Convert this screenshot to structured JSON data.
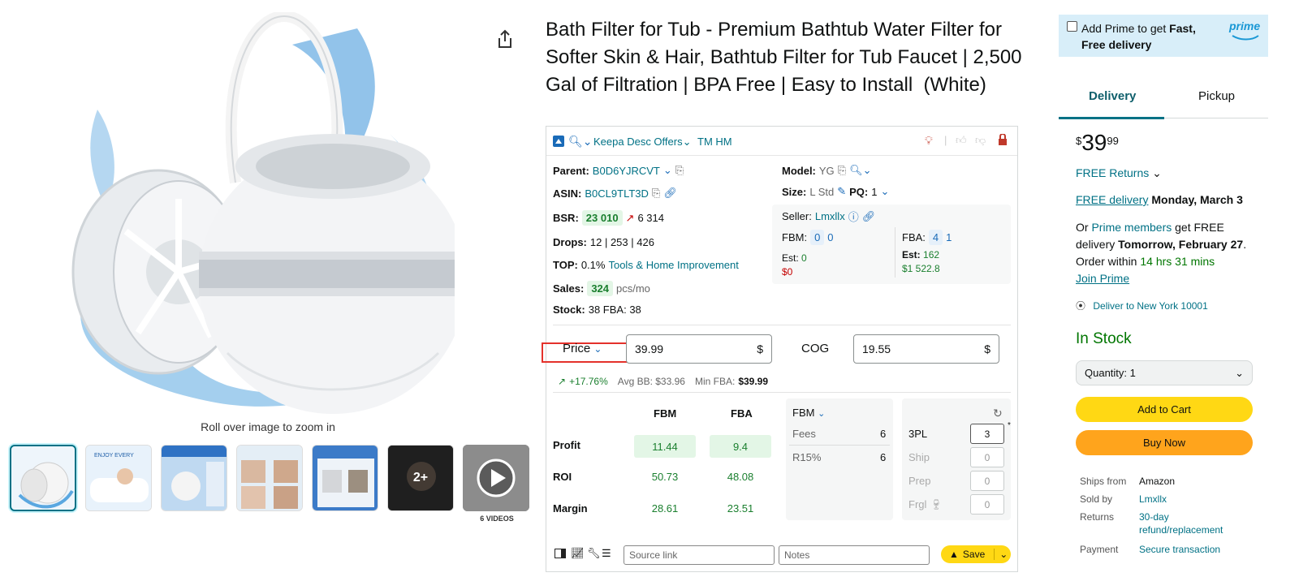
{
  "product": {
    "title": "Bath Filter for Tub - Premium Bathtub Water Filter for Softer Skin & Hair, Bathtub Filter for Tub Faucet | 2,500 Gal of Filtration | BPA Free | Easy to Install  (White)"
  },
  "gallery": {
    "zoom_hint": "Roll over image to zoom in",
    "more_count": "2+",
    "videos_label": "6 VIDEOS"
  },
  "keepa": {
    "toolbar": {
      "menu_label": "Keepa Desc Offers",
      "tm_label": "TM HM"
    },
    "parent_label": "Parent:",
    "parent_value": "B0D6YJRCVT",
    "asin_label": "ASIN:",
    "asin_value": "B0CL9TLT3D",
    "bsr_label": "BSR:",
    "bsr_value": "23 010",
    "bsr_trend": "6 314",
    "drops_label": "Drops:",
    "drops_value": "12 | 253 | 426",
    "top_label": "TOP:",
    "top_value": "0.1%",
    "top_category": "Tools & Home Improvement",
    "sales_label": "Sales:",
    "sales_value": "324",
    "sales_unit": "pcs/mo",
    "stock_label": "Stock:",
    "stock_value": "38 FBA: 38",
    "model_label": "Model:",
    "model_value": "YG",
    "size_label": "Size:",
    "size_value": "L Std",
    "pq_label": "PQ:",
    "pq_value": "1",
    "seller_label": "Seller:",
    "seller_value": "Lmxllx",
    "fbm_label": "FBM:",
    "fbm_count": "0",
    "fbm_count2": "0",
    "fba_label": "FBA:",
    "fba_count": "4",
    "fba_count2": "1",
    "est_label": "Est:",
    "fbm_est_units": "0",
    "fbm_est_money": "$0",
    "fba_est_units": "162",
    "fba_est_money": "$1 522.8",
    "price_label": "Price",
    "price_value": "39.99",
    "currency": "$",
    "cog_label": "COG",
    "cog_value": "19.55",
    "trend_pct": "+17.76%",
    "avg_bb": "Avg BB: $33.96",
    "min_fba_label": "Min FBA:",
    "min_fba_value": "$39.99",
    "table": {
      "col_fbm": "FBM",
      "col_fba": "FBA",
      "rows": [
        {
          "label": "Profit",
          "fbm": "11.44",
          "fba": "9.4"
        },
        {
          "label": "ROI",
          "fbm": "50.73",
          "fba": "48.08"
        },
        {
          "label": "Margin",
          "fbm": "28.61",
          "fba": "23.51"
        }
      ]
    },
    "fees_header": "FBM",
    "fees_label": "Fees",
    "fees_value": "6",
    "r15_label": "R15%",
    "r15_value": "6",
    "tpl_label": "3PL",
    "tpl_value": "3",
    "ship_label": "Ship",
    "ship_value": "0",
    "prep_label": "Prep",
    "prep_value": "0",
    "frgl_label": "Frgl",
    "frgl_value": "0",
    "source_placeholder": "Source link",
    "notes_placeholder": "Notes",
    "save_label": "Save"
  },
  "buybox": {
    "prime_text_1": "Add Prime to get ",
    "prime_bold": "Fast, Free delivery",
    "prime_logo": "prime",
    "tab_delivery": "Delivery",
    "tab_pickup": "Pickup",
    "price_symbol": "$",
    "price_whole": "39",
    "price_fraction": "99",
    "free_returns": "FREE Returns",
    "free_delivery": "FREE delivery",
    "delivery_date": "Monday, March 3",
    "or_text": "Or ",
    "prime_members": "Prime members",
    "get_free": " get FREE delivery ",
    "fast_date": "Tomorrow, February 27",
    "order_within": ". Order within ",
    "countdown": "14 hrs 31 mins",
    "join_prime": "Join Prime",
    "deliver_to": "Deliver to New York 10001",
    "stock_status": "In Stock",
    "quantity_label": "Quantity: 1",
    "add_to_cart": "Add to Cart",
    "buy_now": "Buy Now",
    "ships_from_label": "Ships from",
    "ships_from_value": "Amazon",
    "sold_by_label": "Sold by",
    "sold_by_value": "Lmxllx",
    "returns_label": "Returns",
    "returns_value": "30-day refund/replacement",
    "payment_label": "Payment",
    "payment_value": "Secure transaction"
  },
  "colors": {
    "link": "#007185",
    "cart_yellow": "#ffd814",
    "buy_orange": "#ffa41c",
    "in_stock_green": "#007600",
    "highlight_red": "#e4312b"
  }
}
